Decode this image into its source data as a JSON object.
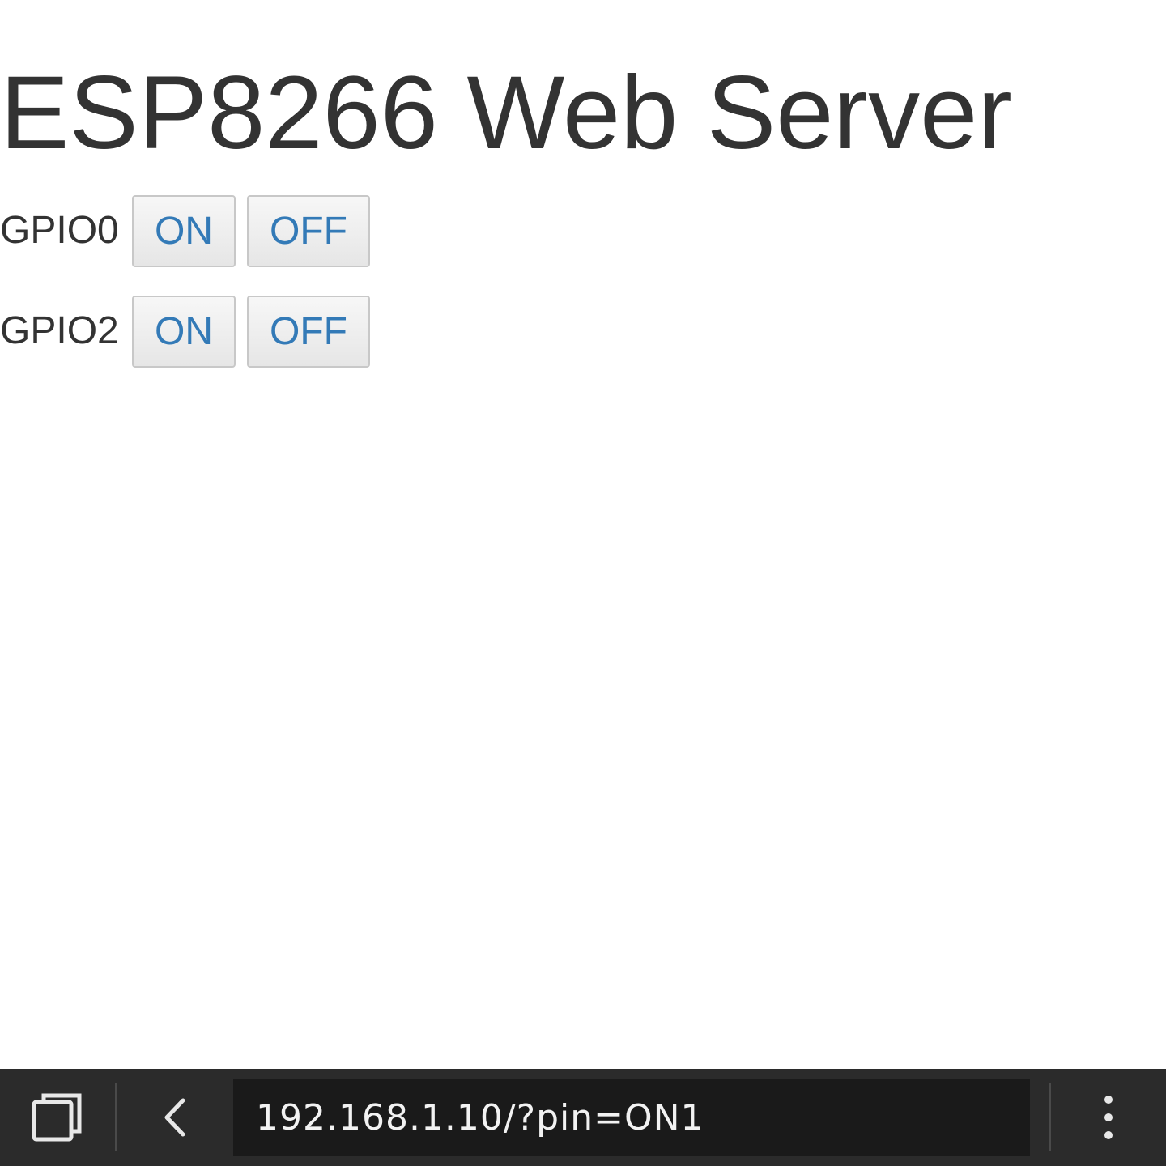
{
  "page": {
    "title": "ESP8266 Web Server"
  },
  "gpio": [
    {
      "label": "GPIO0",
      "on_label": "ON",
      "off_label": "OFF"
    },
    {
      "label": "GPIO2",
      "on_label": "ON",
      "off_label": "OFF"
    }
  ],
  "browser_bar": {
    "url": "192.168.1.10/?pin=ON1",
    "icons": [
      "tabs-icon",
      "back-icon",
      "more-options-icon"
    ]
  },
  "colors": {
    "page_background": "#ffffff",
    "text": "#333333",
    "button_text": "#337ab7",
    "bar_background": "#2b2b2b",
    "url_background": "#1a1a1a"
  }
}
